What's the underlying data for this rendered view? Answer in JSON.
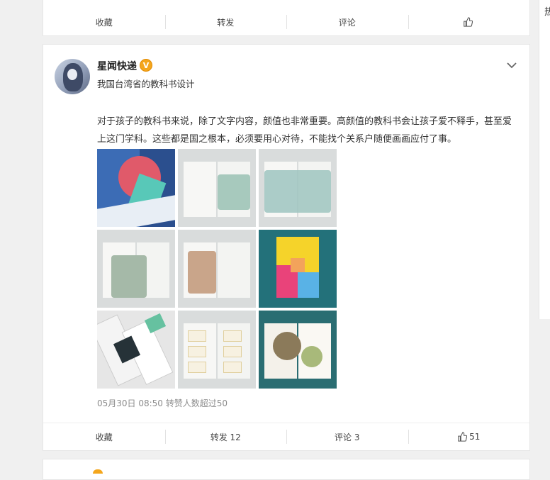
{
  "top_actions": {
    "favorite": "收藏",
    "repost": "转发",
    "comment": "评论"
  },
  "post": {
    "user_name": "星闻快递",
    "verified_badge": "V",
    "user_desc": "我国台湾省的教科书设计",
    "text": "对于孩子的教科书来说，除了文字内容，颜值也非常重要。高颜值的教科书会让孩子爱不释手，甚至爱上这门学科。这些都是国之根本，必须要用心对待，不能找个关系户随便画画应付了事。",
    "meta": "05月30日 08:50 转赞人数超过50",
    "actions": {
      "favorite": "收藏",
      "repost": "转发 12",
      "comment": "评论 3",
      "like": "51"
    }
  },
  "sidebar": {
    "label": "热"
  },
  "icons": {
    "like": "thumbs-up-icon",
    "more": "chevron-down-icon",
    "verified": "verified-badge-icon"
  }
}
